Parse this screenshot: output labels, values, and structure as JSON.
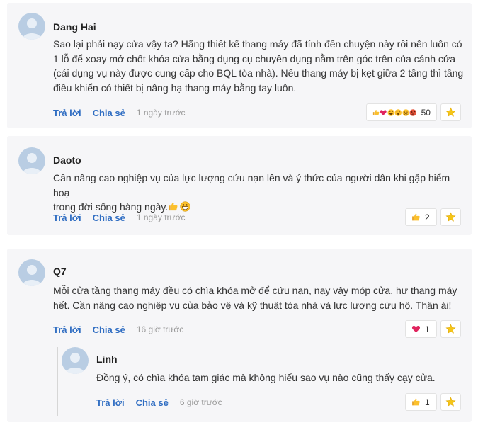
{
  "labels": {
    "reply": "Trả lời",
    "share": "Chia sẻ"
  },
  "comments": [
    {
      "author": "Dang Hai",
      "text": [
        "Sao lại phải nạy cửa vậy ta? Hãng thiết kế thang máy đã tính đến chuyện này rồi nên luôn có",
        "1 lỗ để xoay mở chốt khóa cửa bằng dụng cụ chuyên dụng nằm trên góc trên của cánh cửa",
        "(cái dụng vụ này được cung cấp cho BQL tòa nhà). Nếu thang máy bị kẹt giữa 2 tầng thì tầng",
        "điều khiển có thiết bị nâng hạ thang máy bằng tay luôn."
      ],
      "time": "1 ngày trước",
      "reactions": [
        "like-icon",
        "heart-icon",
        "laugh-icon",
        "wow-icon",
        "sad-icon",
        "angry-icon"
      ],
      "reaction_count": "50"
    },
    {
      "author": "Daoto",
      "text": [
        "Cần nâng cao nghiệp vụ của lực lượng cứu nạn lên và ý thức của người dân khi gặp hiểm hoạ",
        "trong đời sống hàng ngày."
      ],
      "time": "1 ngày trước",
      "inline_emoji": [
        "thumbs-up-icon",
        "grin-icon"
      ],
      "reactions": [
        "like-icon"
      ],
      "reaction_count": "2"
    },
    {
      "author": "Q7",
      "text": [
        "Mỗi cửa tầng thang máy đều có chìa khóa mở để cứu nạn, nạy vậy móp cửa, hư thang máy",
        "hết. Cần nâng cao nghiệp vụ của bảo vệ và kỹ thuật tòa nhà và lực lượng cứu hộ. Thân ái!"
      ],
      "time": "16 giờ trước",
      "reactions": [
        "heart-icon"
      ],
      "reaction_count": "1",
      "replies": [
        {
          "author": "Linh",
          "text": [
            "Đồng ý, có chìa khóa tam giác mà không hiểu sao vụ nào cũng thấy cạy cửa."
          ],
          "time": "6 giờ trước",
          "reactions": [
            "like-icon"
          ],
          "reaction_count": "1"
        }
      ]
    }
  ],
  "colors": {
    "link": "#2f6dc2",
    "card_bg": "#f6f6f8",
    "star": "#f5c518",
    "heart": "#e0245e"
  }
}
